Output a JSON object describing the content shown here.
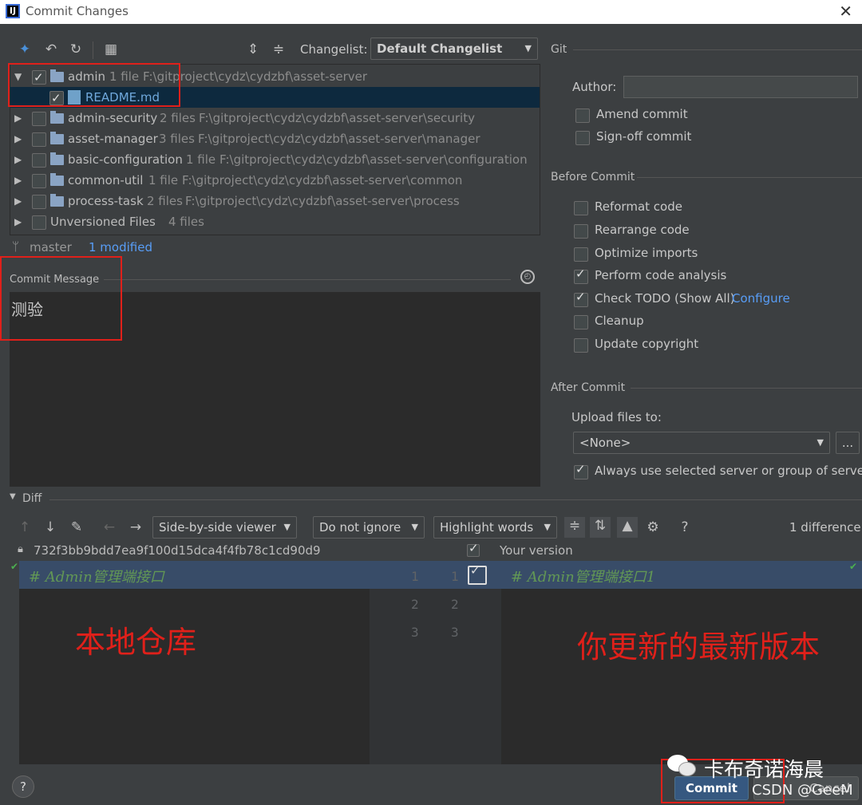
{
  "window": {
    "title": "Commit Changes",
    "app_icon": "IJ"
  },
  "toolbar": {
    "changelist_label": "Changelist:",
    "changelist_value": "Default Changelist"
  },
  "tree": [
    {
      "name": "admin",
      "count": "1 file",
      "path": "F:\\gitproject\\cydz\\cydzbf\\asset-server",
      "checked": true,
      "expanded": true
    },
    {
      "name": "README.md",
      "file": true,
      "checked": true
    },
    {
      "name": "admin-security",
      "count": "2 files",
      "path": "F:\\gitproject\\cydz\\cydzbf\\asset-server\\security",
      "checked": false
    },
    {
      "name": "asset-manager",
      "count": "3 files",
      "path": "F:\\gitproject\\cydz\\cydzbf\\asset-server\\manager",
      "checked": false
    },
    {
      "name": "basic-configuration",
      "count": "1 file",
      "path": "F:\\gitproject\\cydz\\cydzbf\\asset-server\\configuration",
      "checked": false
    },
    {
      "name": "common-util",
      "count": "1 file",
      "path": "F:\\gitproject\\cydz\\cydzbf\\asset-server\\common",
      "checked": false
    },
    {
      "name": "process-task",
      "count": "2 files",
      "path": "F:\\gitproject\\cydz\\cydzbf\\asset-server\\process",
      "checked": false
    },
    {
      "name": "Unversioned Files",
      "count": "4 files",
      "checked": false
    }
  ],
  "status": {
    "branch": "master",
    "modified": "1 modified"
  },
  "commit_message": {
    "label": "Commit Message",
    "text": "测验"
  },
  "git": {
    "section": "Git",
    "author_label": "Author:",
    "author_value": "",
    "amend": "Amend commit",
    "signoff": "Sign-off commit"
  },
  "before_commit": {
    "section": "Before Commit",
    "options": [
      {
        "label": "Reformat code",
        "checked": false
      },
      {
        "label": "Rearrange code",
        "checked": false
      },
      {
        "label": "Optimize imports",
        "checked": false
      },
      {
        "label": "Perform code analysis",
        "checked": true
      },
      {
        "label": "Check TODO (Show All)",
        "checked": true,
        "link": "Configure"
      },
      {
        "label": "Cleanup",
        "checked": false
      },
      {
        "label": "Update copyright",
        "checked": false
      }
    ]
  },
  "after_commit": {
    "section": "After Commit",
    "upload_label": "Upload files to:",
    "upload_value": "<None>",
    "browse": "...",
    "always_use": "Always use selected server or group of servers"
  },
  "diff": {
    "section": "Diff",
    "viewer": "Side-by-side viewer",
    "ignore": "Do not ignore",
    "highlight": "Highlight words",
    "help": "?",
    "differences": "1 difference",
    "left_hash": "732f3bb9bdd7ea9f100d15dca4f4fb78c1cd90d9",
    "right_title": "Your version",
    "left_line": "# Admin管理端接口",
    "right_line": "# Admin管理端接口1",
    "left_numbers": [
      "1",
      "2",
      "3"
    ],
    "right_numbers": [
      "1",
      "2",
      "3"
    ]
  },
  "annotations": {
    "local_repo": "本地仓库",
    "latest_version": "你更新的最新版本"
  },
  "footer": {
    "help": "?",
    "commit": "Commit",
    "cancel": "Cancel"
  },
  "watermark": {
    "account": "卡布奇诺海晨",
    "csdn": "CSDN @GeeM"
  },
  "colors": {
    "accent": "#365880",
    "annotation_red": "#e0201a",
    "link": "#589df6"
  }
}
